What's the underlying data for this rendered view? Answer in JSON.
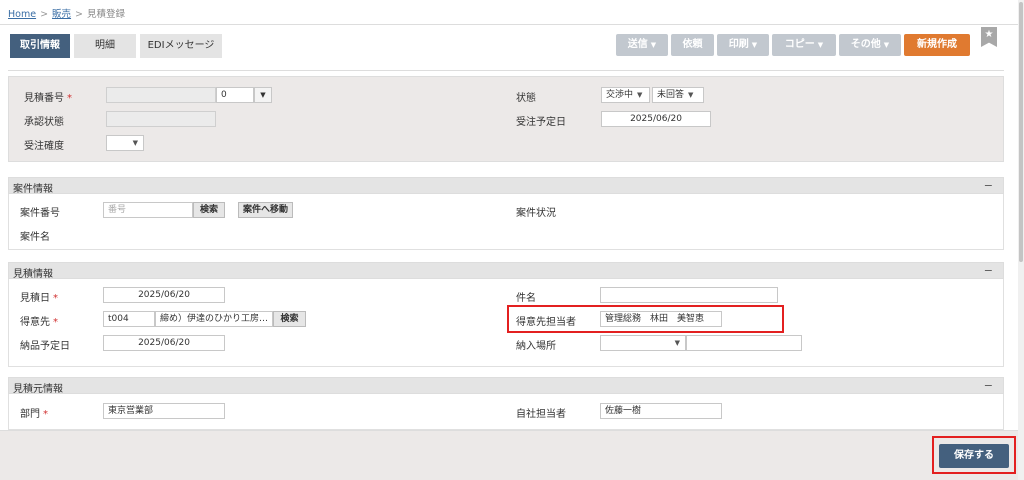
{
  "breadcrumb": {
    "home": "Home",
    "sales": "販売",
    "current": "見積登録",
    "sep": ">"
  },
  "tabs": [
    {
      "label": "取引情報",
      "active": true
    },
    {
      "label": "明細",
      "active": false
    },
    {
      "label": "EDIメッセージ",
      "active": false
    }
  ],
  "toolbar": {
    "send": "送信",
    "request": "依頼",
    "print": "印刷",
    "copy": "コピー",
    "other": "その他",
    "new": "新規作成",
    "caret": "▼"
  },
  "header": {
    "estimate_no_label": "見積番号",
    "estimate_no_value": "",
    "estimate_no_suffix": "0",
    "approval_label": "承認状態",
    "approval_value": "",
    "order_prob_label": "受注確度",
    "order_prob_value": "",
    "status_label": "状態",
    "status_value1": "交渉中",
    "status_value2": "未回答",
    "order_date_label": "受注予定日",
    "order_date_value": "2025/06/20",
    "required_mark": "*"
  },
  "project": {
    "title": "案件情報",
    "collapse": "−",
    "no_label": "案件番号",
    "no_placeholder": "番号",
    "search_btn": "検索",
    "goto_btn": "案件へ移動",
    "status_label": "案件状況",
    "name_label": "案件名"
  },
  "estimate": {
    "title": "見積情報",
    "collapse": "−",
    "date_label": "見積日",
    "date_value": "2025/06/20",
    "customer_label": "得意先",
    "customer_code": "t004",
    "customer_name": "締め）伊達のひかり工房…",
    "search_btn": "検索",
    "delivery_date_label": "納品予定日",
    "delivery_date_value": "2025/06/20",
    "subject_label": "件名",
    "subject_value": "",
    "contact_label": "得意先担当者",
    "contact_value": "管理総務　林田　美智恵",
    "place_label": "納入場所",
    "place_value": "",
    "required_mark": "*"
  },
  "source": {
    "title": "見積元情報",
    "collapse": "−",
    "dept_label": "部門",
    "dept_value": "東京営業部",
    "staff_label": "自社担当者",
    "staff_value": "佐藤一樹",
    "required_mark": "*"
  },
  "footer": {
    "save": "保存する"
  },
  "colors": {
    "primary": "#44607e",
    "accent": "#e07a30",
    "highlight": "#e32020",
    "required": "#d03030"
  }
}
